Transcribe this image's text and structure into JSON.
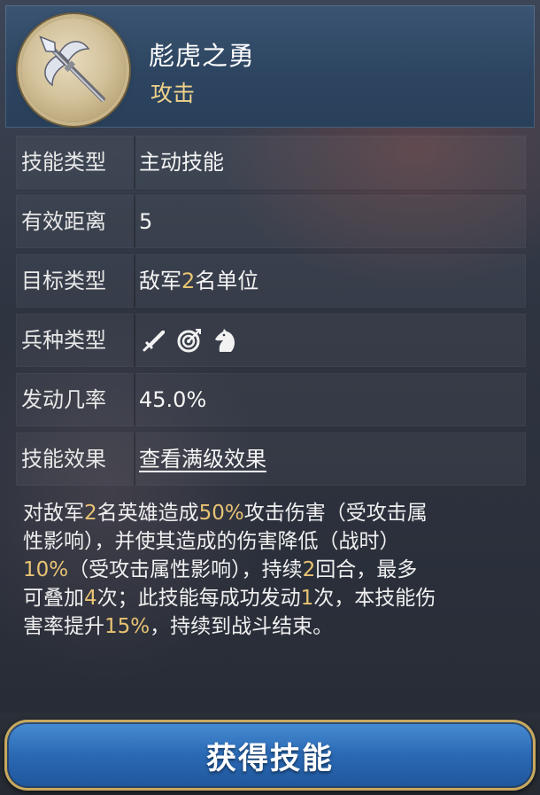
{
  "skill": {
    "name": "彪虎之勇",
    "tag": "攻击",
    "icon": "halberd-icon"
  },
  "rows": [
    {
      "label": "技能类型",
      "value": "主动技能"
    },
    {
      "label": "有效距离",
      "value": "5"
    },
    {
      "label": "目标类型",
      "value_pre": "敌军",
      "value_num": "2",
      "value_post": "名单位"
    },
    {
      "label": "兵种类型",
      "icons": [
        "sword-icon",
        "target-icon",
        "horse-icon"
      ]
    },
    {
      "label": "发动几率",
      "value": "45.0%"
    },
    {
      "label": "技能效果",
      "link": "查看满级效果"
    }
  ],
  "description": {
    "l1": [
      "对敌军",
      "2",
      "名英雄造成",
      "50%",
      "攻击伤害（受攻击属"
    ],
    "l2": "性影响），并使其造成的伤害降低（战时）",
    "l3": [
      "10%",
      "（受攻击属性影响），持续",
      "2",
      "回合，最多"
    ],
    "l4": [
      "可叠加",
      "4",
      "次；此技能每成功发动",
      "1",
      "次，本技能伤"
    ],
    "l5": [
      "害率提升",
      "15%",
      "，持续到战斗结束。"
    ]
  },
  "button": {
    "label": "获得技能"
  },
  "colors": {
    "highlight": "#e8c373",
    "button": "#2a69b4",
    "header": "#2d4560"
  }
}
